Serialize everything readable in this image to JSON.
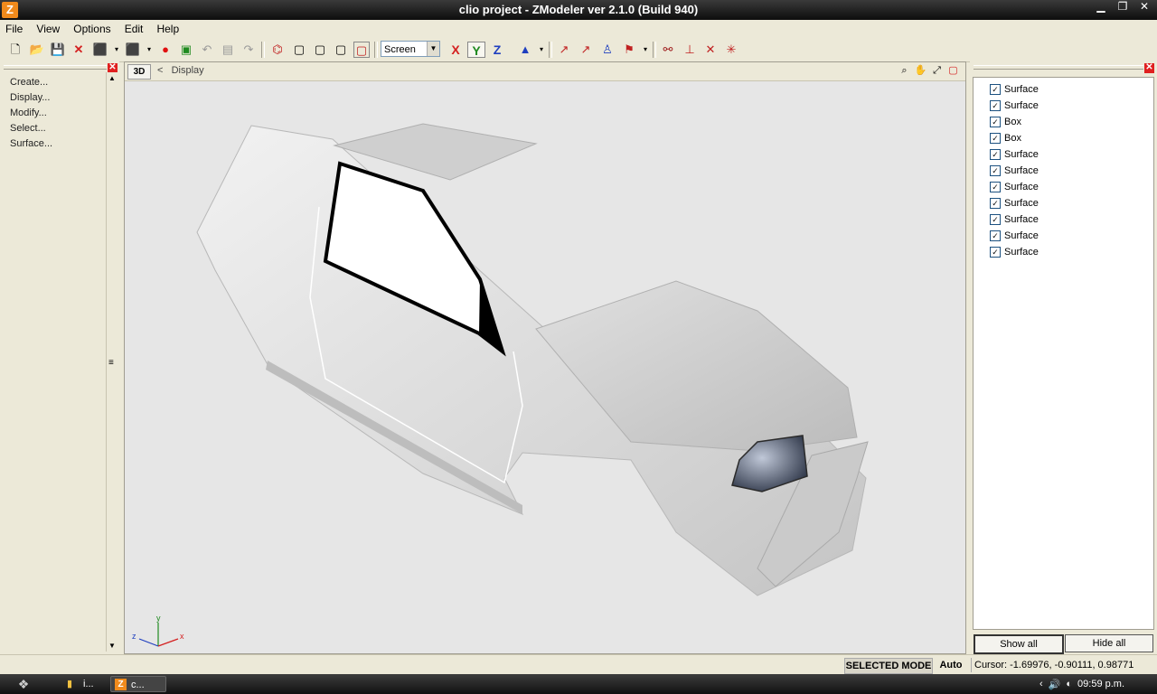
{
  "window": {
    "title": "clio project - ZModeler ver 2.1.0 (Build 940)",
    "app_icon": "Z"
  },
  "window_controls": {
    "minimize": "▁",
    "maximize": "❐",
    "close": "✕"
  },
  "menu": [
    "File",
    "View",
    "Options",
    "Edit",
    "Help"
  ],
  "toolbar": {
    "view_mode": "Screen",
    "axis_x": "X",
    "axis_y": "Y",
    "axis_z": "Z",
    "colors": {
      "x": "#d42020",
      "y": "#1f8a1f",
      "z": "#1f3fbf"
    }
  },
  "left_panel": {
    "items": [
      "Create...",
      "Display...",
      "Modify...",
      "Select...",
      "Surface..."
    ],
    "close": "✕"
  },
  "viewport": {
    "tag": "3D",
    "breadcrumb_arrow": "<",
    "breadcrumb": "Display",
    "axes": {
      "x": "x",
      "y": "y",
      "z": "z"
    }
  },
  "right_panel": {
    "close": "✕",
    "objects": [
      {
        "label": "Surface",
        "checked": true
      },
      {
        "label": "Surface",
        "checked": true
      },
      {
        "label": "Box",
        "checked": true
      },
      {
        "label": "Box",
        "checked": true
      },
      {
        "label": "Surface",
        "checked": true
      },
      {
        "label": "Surface",
        "checked": true
      },
      {
        "label": "Surface",
        "checked": true
      },
      {
        "label": "Surface",
        "checked": true
      },
      {
        "label": "Surface",
        "checked": true
      },
      {
        "label": "Surface",
        "checked": true
      },
      {
        "label": "Surface",
        "checked": true
      }
    ],
    "check_mark": "✓",
    "show_all": "Show all",
    "hide_all": "Hide all"
  },
  "status": {
    "mode": "SELECTED MODE",
    "auto": "Auto",
    "cursor": "Cursor: -1.69976, -0.90111, 0.98771"
  },
  "taskbar": {
    "items": [
      {
        "label": "i..."
      },
      {
        "label": "c..."
      }
    ],
    "clock": "09:59 p.m."
  }
}
